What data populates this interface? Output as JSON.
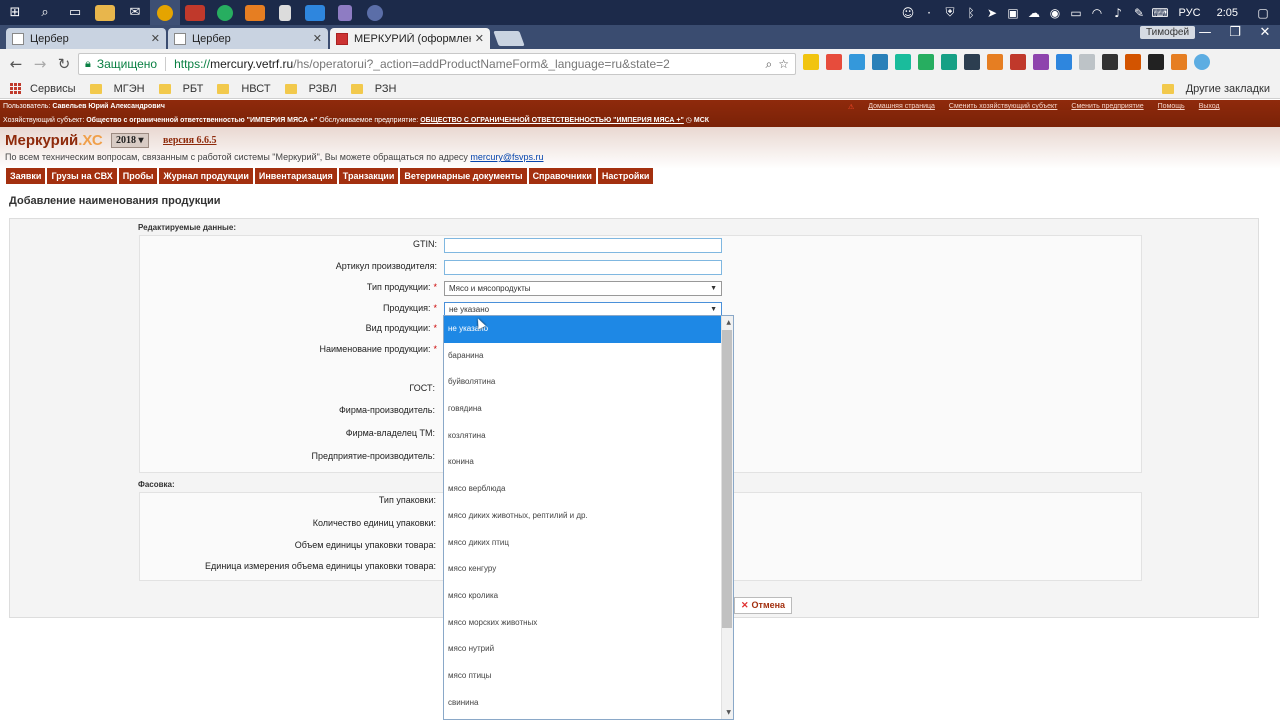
{
  "taskbar": {
    "tray_lang": "РУС",
    "tray_time": "2:05"
  },
  "browser": {
    "tabs": [
      {
        "title": "Цербер"
      },
      {
        "title": "Цербер"
      },
      {
        "title": "МЕРКУРИЙ (оформлени"
      }
    ],
    "profile_name": "Тимофей",
    "address": {
      "secure_label": "Защищено",
      "scheme": "https://",
      "host": "mercury.vetrf.ru",
      "path": "/hs/operatorui?_action=addProductNameForm&_language=ru&state=2"
    },
    "bookmarks": [
      "Сервисы",
      "МГЭН",
      "РБТ",
      "НВСТ",
      "РЗВЛ",
      "РЗН"
    ],
    "other_bookmarks": "Другие закладки"
  },
  "header": {
    "user_label": "Пользователь:",
    "user_name": "Савельев Юрий Александрович",
    "entity_label": "Хозяйствующий субъект:",
    "entity_name": "Общество с ограниченной ответственностью \"ИМПЕРИЯ МЯСА +\"",
    "enterprise_label": "Обслуживаемое предприятие:",
    "enterprise_name": "ОБЩЕСТВО С ОГРАНИЧЕННОЙ ОТВЕТСТВЕННОСТЬЮ \"ИМПЕРИЯ МЯСА +\"",
    "timezone": "МСК",
    "links": [
      "Домашняя страница",
      "Сменить хозяйствующий субъект",
      "Сменить предприятие",
      "Помощь",
      "Выход"
    ],
    "brand": "Меркурий",
    "brand_suffix": ".ХС",
    "year": "2018 ▾",
    "version": "версия 6.6.5",
    "support_text": "По всем техническим вопросам, связанным с работой системы \"Меркурий\", Вы можете обращаться по адресу ",
    "support_email": "mercury@fsvps.ru"
  },
  "menu": [
    "Заявки",
    "Грузы на СВХ",
    "Пробы",
    "Журнал продукции",
    "Инвентаризация",
    "Транзакции",
    "Ветеринарные документы",
    "Справочники",
    "Настройки"
  ],
  "page_title": "Добавление наименования продукции",
  "form": {
    "editable_section": "Редактируемые данные:",
    "packaging_section": "Фасовка:",
    "fields": {
      "gtin": "GTIN:",
      "article": "Артикул производителя:",
      "product_type": "Тип продукции:",
      "product": "Продукция:",
      "product_kind": "Вид продукции:",
      "product_name": "Наименование продукции:",
      "gost": "ГОСТ:",
      "manufacturer": "Фирма-производитель:",
      "tm_owner": "Фирма-владелец ТМ:",
      "producer_enterprise": "Предприятие-производитель:",
      "package_type": "Тип упаковки:",
      "package_count": "Количество единиц упаковки:",
      "package_volume": "Объем единицы упаковки товара:",
      "package_unit": "Единица измерения объема единицы упаковки товара:"
    },
    "product_type_value": "Мясо и мясопродукты",
    "product_value": "не указано",
    "cancel_label": "Отмена"
  },
  "dropdown": {
    "options": [
      "не указано",
      "баранина",
      "буйволятина",
      "говядина",
      "козлятина",
      "конина",
      "мясо верблюда",
      "мясо диких животных, рептилий и др.",
      "мясо диких птиц",
      "мясо кенгуру",
      "мясо кролика",
      "мясо морских животных",
      "мясо нутрий",
      "мясо птицы",
      "свинина"
    ]
  }
}
